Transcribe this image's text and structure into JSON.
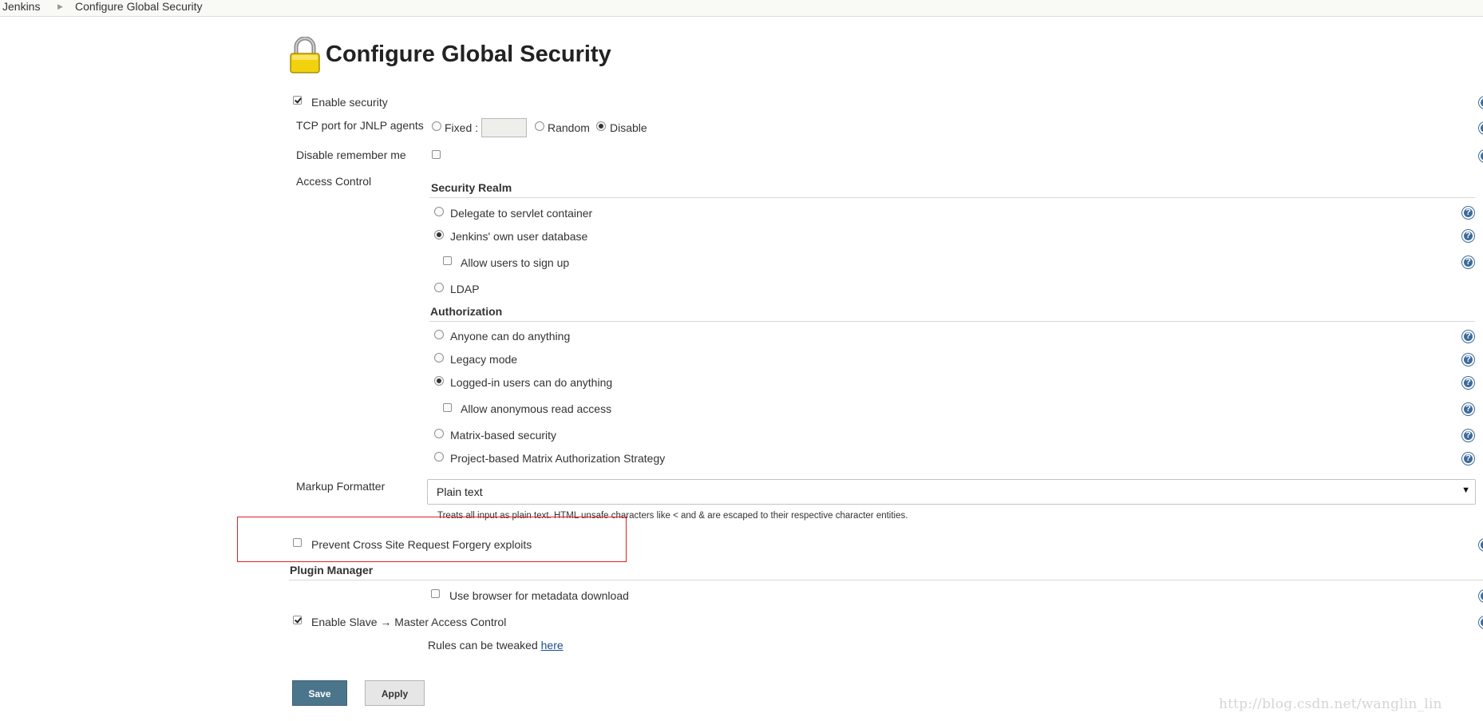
{
  "breadcrumb": {
    "root": "Jenkins",
    "current": "Configure Global Security"
  },
  "page": {
    "title": "Configure Global Security",
    "title_icon": "lock-icon"
  },
  "form": {
    "enable_security": {
      "label": "Enable security",
      "checked": true
    },
    "tcp_port": {
      "label": "TCP port for JNLP agents",
      "fixed_label": "Fixed :",
      "fixed_value": "",
      "random_label": "Random",
      "disable_label": "Disable",
      "selected": "Disable"
    },
    "disable_remember_me": {
      "label": "Disable remember me",
      "checked": false
    },
    "access_control": {
      "label": "Access Control",
      "security_realm": {
        "title": "Security Realm",
        "options": [
          {
            "label": "Delegate to servlet container",
            "selected": false
          },
          {
            "label": "Jenkins' own user database",
            "selected": true
          },
          {
            "label": "LDAP",
            "selected": false
          }
        ],
        "allow_signup": {
          "label": "Allow users to sign up",
          "checked": false
        }
      },
      "authorization": {
        "title": "Authorization",
        "options": [
          {
            "label": "Anyone can do anything",
            "selected": false
          },
          {
            "label": "Legacy mode",
            "selected": false
          },
          {
            "label": "Logged-in users can do anything",
            "selected": true
          },
          {
            "label": "Matrix-based security",
            "selected": false
          },
          {
            "label": "Project-based Matrix Authorization Strategy",
            "selected": false
          }
        ],
        "allow_anonymous_read": {
          "label": "Allow anonymous read access",
          "checked": false
        }
      }
    },
    "markup_formatter": {
      "label": "Markup Formatter",
      "selected": "Plain text",
      "description": "Treats all input as plain text. HTML unsafe characters like < and & are escaped to their respective character entities."
    },
    "csrf": {
      "label": "Prevent Cross Site Request Forgery exploits",
      "checked": false
    },
    "plugin_manager": {
      "title": "Plugin Manager",
      "browser_metadata": {
        "label": "Use browser for metadata download",
        "checked": false
      }
    },
    "slave_master": {
      "label": "Enable Slave → Master Access Control",
      "checked": true,
      "rules_text": "Rules can be tweaked ",
      "rules_link": "here"
    }
  },
  "buttons": {
    "save": "Save",
    "apply": "Apply"
  },
  "help_icon_glyph": "?",
  "watermark": "http://blog.csdn.net/wanglin_lin",
  "colors": {
    "save_button": "#4b758b",
    "help_icon": "#3d6b99",
    "highlight_box": "#e02020",
    "link": "#1a4f8e"
  }
}
